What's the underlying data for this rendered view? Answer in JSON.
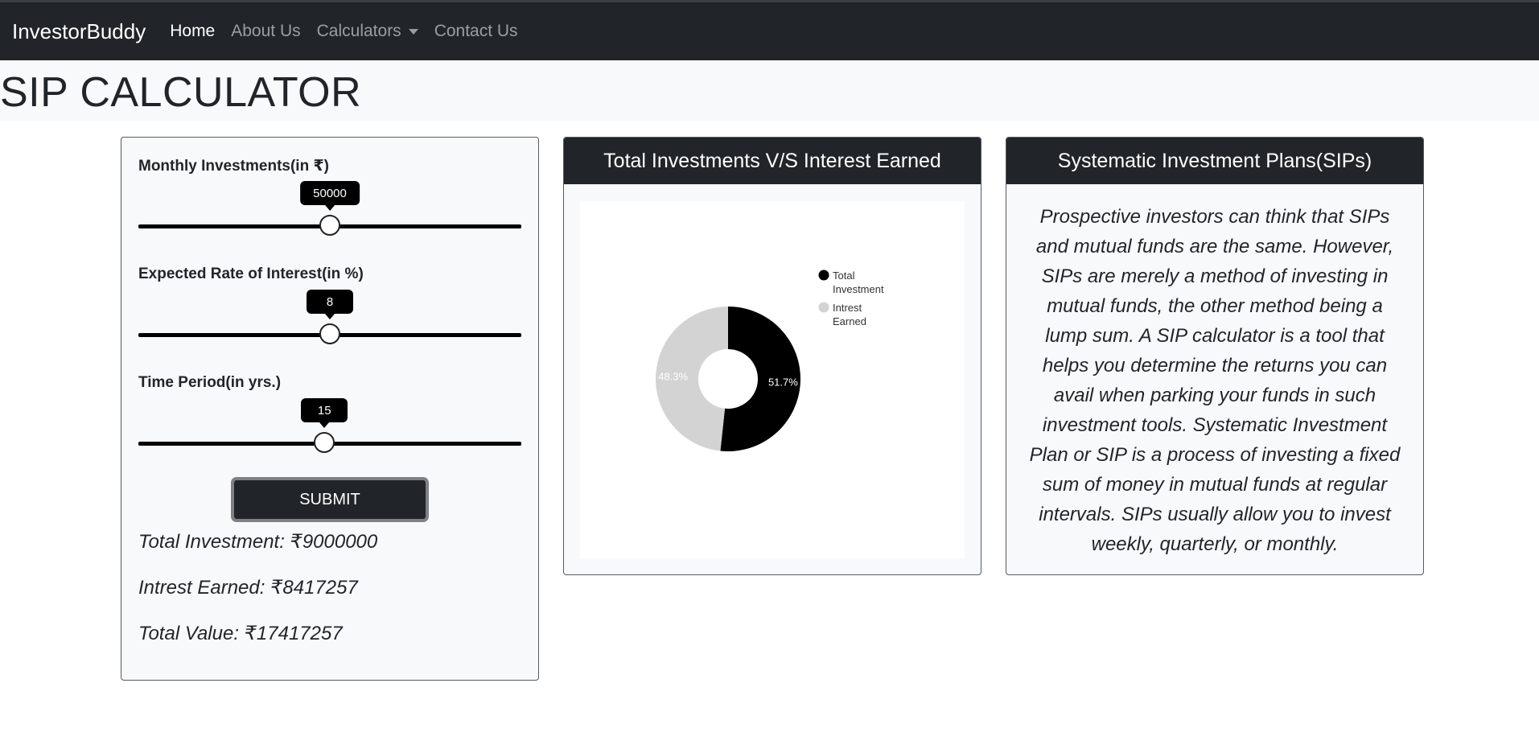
{
  "nav": {
    "brand": "InvestorBuddy",
    "links": [
      "Home",
      "About Us",
      "Calculators",
      "Contact Us"
    ]
  },
  "page": {
    "title": "SIP CALCULATOR"
  },
  "calculator": {
    "sliders": [
      {
        "label": "Monthly Investments(in ₹)",
        "value": "50000",
        "position": 0.5
      },
      {
        "label": "Expected Rate of Interest(in %)",
        "value": "8",
        "position": 0.5
      },
      {
        "label": "Time Period(in yrs.)",
        "value": "15",
        "position": 0.485
      }
    ],
    "submit_label": "SUBMIT",
    "results": {
      "total_investment": "Total Investment: ₹9000000",
      "interest_earned": "Intrest Earned: ₹8417257",
      "total_value": "Total Value: ₹17417257"
    }
  },
  "chart_card": {
    "title": "Total Investments V/S Interest Earned"
  },
  "chart_data": {
    "type": "pie",
    "categories": [
      "Total Investment",
      "Intrest Earned"
    ],
    "values": [
      51.7,
      48.3
    ],
    "labels": [
      "51.7%",
      "48.3%"
    ],
    "colors": [
      "#000000",
      "#d3d3d3"
    ],
    "label_colors": [
      "#ffffff",
      "#ffffff"
    ],
    "donut": true,
    "legend_position": "right"
  },
  "info_card": {
    "title": "Systematic Investment Plans(SIPs)",
    "text": "Prospective investors can think that SIPs and mutual funds are the same. However, SIPs are merely a method of investing in mutual funds, the other method being a lump sum. A SIP calculator is a tool that helps you determine the returns you can avail when parking your funds in such investment tools. Systematic Investment Plan or SIP is a process of investing a fixed sum of money in mutual funds at regular intervals. SIPs usually allow you to invest weekly, quarterly, or monthly."
  }
}
